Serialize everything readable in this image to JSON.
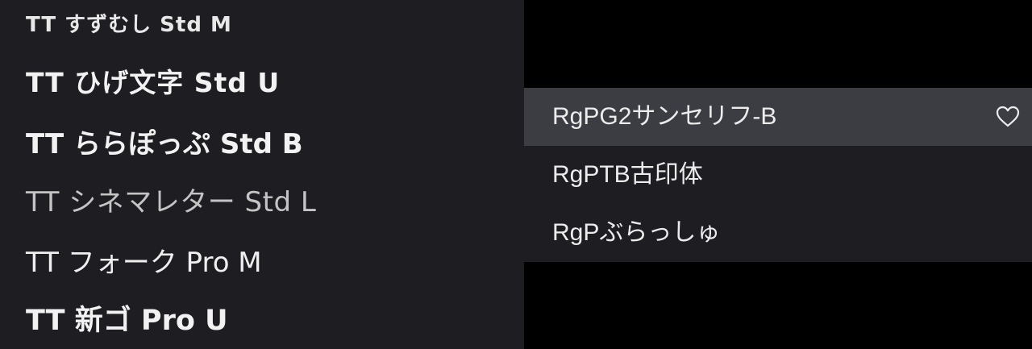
{
  "font_list": {
    "items": [
      "TT すずむし Std M",
      "TT ひげ文字 Std U",
      "TT ららぽっぷ Std B",
      "TT シネマレター Std L",
      "TT フォーク Pro M",
      "TT 新ゴ Pro U"
    ]
  },
  "submenu": {
    "items": [
      "RgPG2サンセリフ-B",
      "RgPTB古印体",
      "RgPぶらっしゅ"
    ],
    "highlighted_index": 0,
    "favorite_icon": "heart-outline-icon"
  },
  "colors": {
    "panel_bg": "#1e1e22",
    "highlight_bg": "#3c3c43",
    "backdrop": "#000000",
    "text": "#f2f2f2"
  }
}
